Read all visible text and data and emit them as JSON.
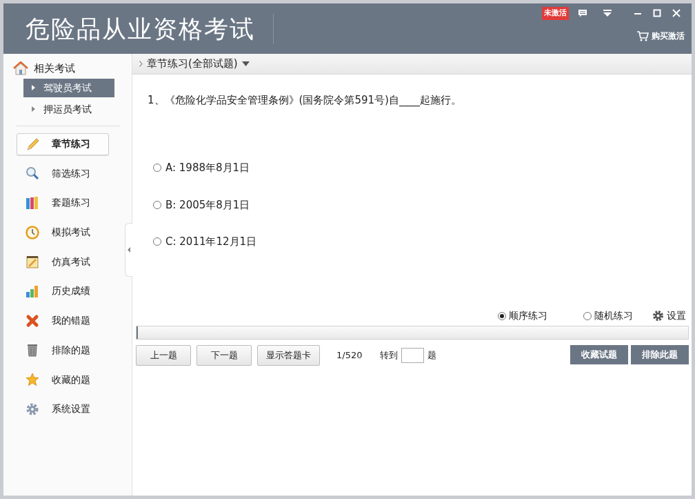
{
  "window": {
    "title": "危险品从业资格考试",
    "badge": "未激活",
    "buy_link": "购买激活"
  },
  "sidebar": {
    "group": {
      "label": "相关考试",
      "items": [
        {
          "label": "驾驶员考试",
          "selected": true
        },
        {
          "label": "押运员考试",
          "selected": false
        }
      ]
    },
    "nav": [
      {
        "label": "章节练习",
        "kind": "pencil",
        "selected": true
      },
      {
        "label": "筛选练习",
        "kind": "magnifier",
        "selected": false
      },
      {
        "label": "套题练习",
        "kind": "books",
        "selected": false
      },
      {
        "label": "模拟考试",
        "kind": "clock",
        "selected": false
      },
      {
        "label": "仿真考试",
        "kind": "notepad",
        "selected": false
      },
      {
        "label": "历史成绩",
        "kind": "chart",
        "selected": false
      },
      {
        "label": "我的错题",
        "kind": "cross",
        "selected": false
      },
      {
        "label": "排除的题",
        "kind": "trash",
        "selected": false
      },
      {
        "label": "收藏的题",
        "kind": "star",
        "selected": false
      },
      {
        "label": "系统设置",
        "kind": "gear",
        "selected": false
      }
    ]
  },
  "breadcrumb": "章节练习(全部试题)",
  "question": {
    "text": "1、《危险化学品安全管理条例》(国务院令第591号)自____起施行。",
    "options": [
      {
        "label": "A: 1988年8月1日",
        "selected": false
      },
      {
        "label": "B: 2005年8月1日",
        "selected": false
      },
      {
        "label": "C: 2011年12月1日",
        "selected": false
      }
    ]
  },
  "modes": [
    {
      "label": "顺序练习",
      "selected": true
    },
    {
      "label": "随机练习",
      "selected": false
    }
  ],
  "settings_label": "设置",
  "progress": {
    "level": 0.002
  },
  "buttons": [
    "上一题",
    "下一题",
    "显示答题卡"
  ],
  "counter": "1/520",
  "goto": {
    "prefix": "转到",
    "suffix": "题"
  },
  "actions": [
    "收藏试题",
    "排除此题"
  ]
}
